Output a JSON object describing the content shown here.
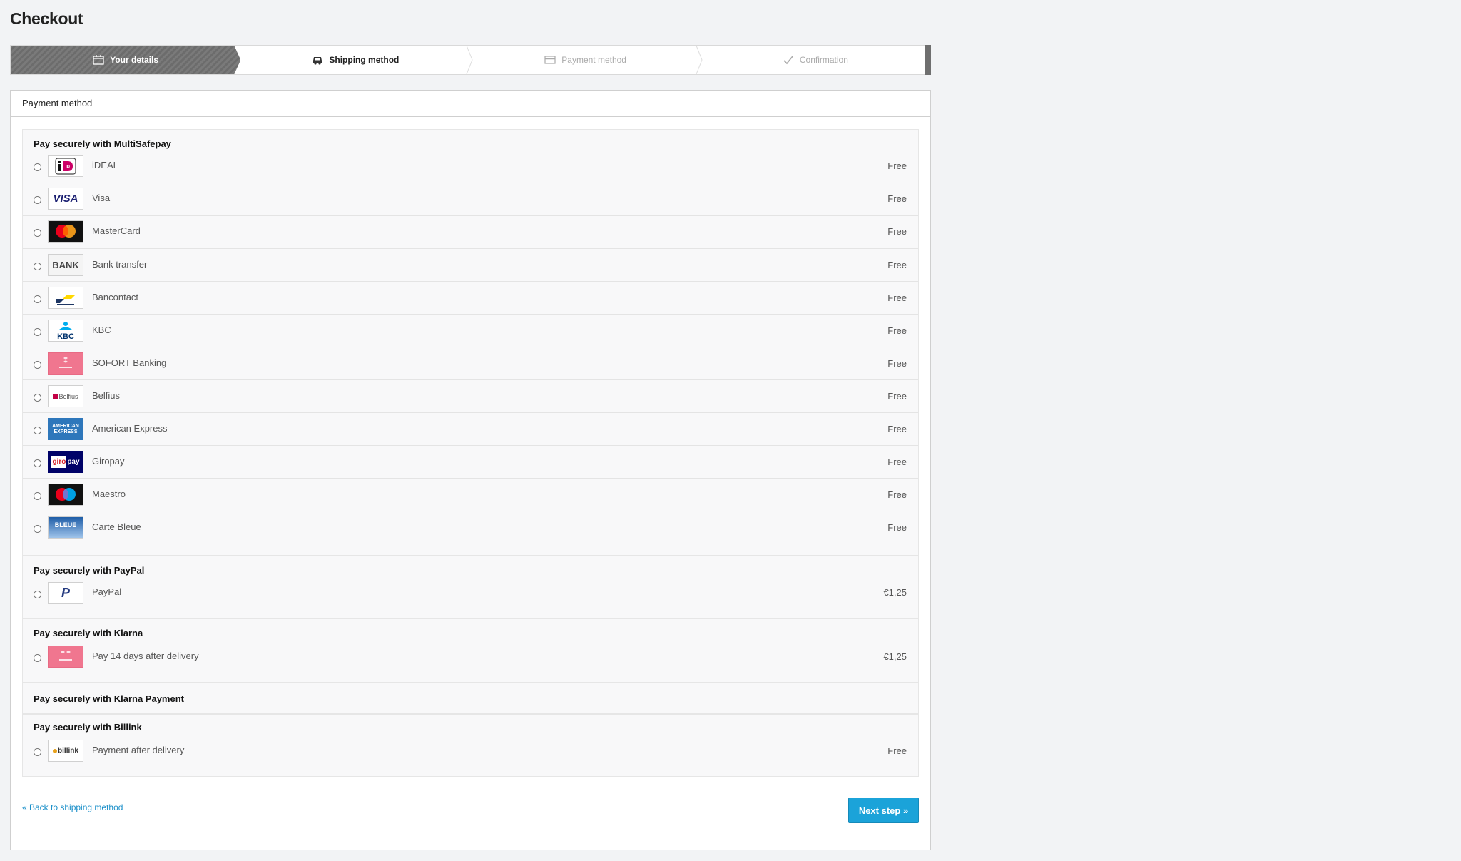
{
  "page": {
    "title": "Checkout"
  },
  "steps": [
    {
      "label": "Your details",
      "icon": "calendar-icon",
      "state": "done"
    },
    {
      "label": "Shipping method",
      "icon": "truck-icon",
      "state": "active"
    },
    {
      "label": "Payment method",
      "icon": "card-icon",
      "state": "upcoming"
    },
    {
      "label": "Confirmation",
      "icon": "check-icon",
      "state": "upcoming"
    }
  ],
  "panel": {
    "title": "Payment method"
  },
  "groups": [
    {
      "title": "Pay securely with MultiSafepay",
      "methods": [
        {
          "label": "iDEAL",
          "price": "Free",
          "logo": "ideal-logo"
        },
        {
          "label": "Visa",
          "price": "Free",
          "logo": "visa-logo"
        },
        {
          "label": "MasterCard",
          "price": "Free",
          "logo": "mastercard-logo"
        },
        {
          "label": "Bank transfer",
          "price": "Free",
          "logo": "bank-logo"
        },
        {
          "label": "Bancontact",
          "price": "Free",
          "logo": "bancontact-logo"
        },
        {
          "label": "KBC",
          "price": "Free",
          "logo": "kbc-logo"
        },
        {
          "label": "SOFORT Banking",
          "price": "Free",
          "logo": "sofort-logo"
        },
        {
          "label": "Belfius",
          "price": "Free",
          "logo": "belfius-logo"
        },
        {
          "label": "American Express",
          "price": "Free",
          "logo": "amex-logo"
        },
        {
          "label": "Giropay",
          "price": "Free",
          "logo": "giropay-logo"
        },
        {
          "label": "Maestro",
          "price": "Free",
          "logo": "maestro-logo"
        },
        {
          "label": "Carte Bleue",
          "price": "Free",
          "logo": "cartebleue-logo"
        }
      ]
    },
    {
      "title": "Pay securely with PayPal",
      "methods": [
        {
          "label": "PayPal",
          "price": "€1,25",
          "logo": "paypal-logo"
        }
      ]
    },
    {
      "title": "Pay securely with Klarna",
      "methods": [
        {
          "label": "Pay 14 days after delivery",
          "price": "€1,25",
          "logo": "klarna-logo"
        }
      ]
    },
    {
      "title": "Pay securely with Klarna Payment",
      "methods": []
    },
    {
      "title": "Pay securely with Billink",
      "methods": [
        {
          "label": "Payment after delivery",
          "price": "Free",
          "logo": "billink-logo"
        }
      ]
    }
  ],
  "logo_text": {
    "ideal": "iD",
    "visa": "VISA",
    "bank": "BANK",
    "kbc": "KBC",
    "belfius": "Belfius",
    "amex": "AMERICAN EXPRESS",
    "giro": "giro",
    "pay": "pay",
    "bleue": "BLEUE",
    "paypal": "P",
    "billink": "billink"
  },
  "footer": {
    "back_label": "« Back to shipping method",
    "next_label": "Next step »"
  },
  "colors": {
    "accent": "#1ba3d9",
    "link": "#1a8fc9",
    "done_step": "#777777"
  }
}
